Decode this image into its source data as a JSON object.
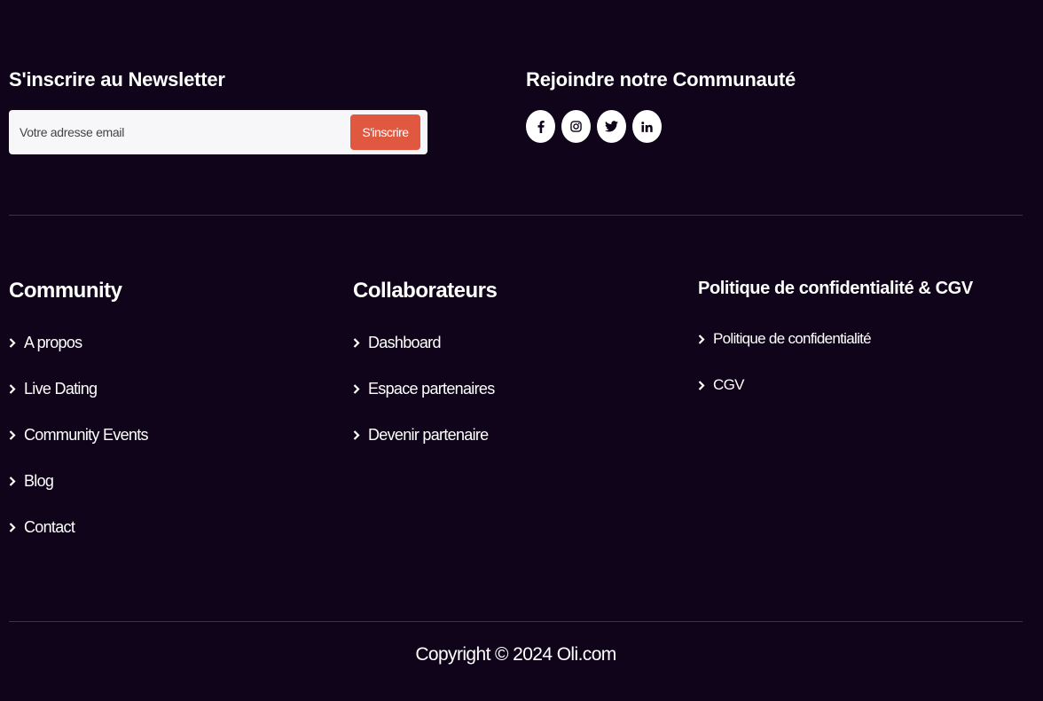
{
  "newsletter": {
    "title": "S'inscrire au Newsletter",
    "email_placeholder": "Votre adresse email",
    "submit_label": "S'inscrire"
  },
  "community": {
    "title": "Rejoindre notre Communauté",
    "socials": [
      {
        "icon": "facebook-icon"
      },
      {
        "icon": "instagram-icon"
      },
      {
        "icon": "twitter-icon"
      },
      {
        "icon": "linkedin-icon"
      }
    ]
  },
  "columns": [
    {
      "title": "Community",
      "links": [
        "A propos",
        "Live Dating",
        "Community Events",
        "Blog",
        "Contact"
      ]
    },
    {
      "title": "Collaborateurs",
      "links": [
        "Dashboard",
        "Espace partenaires",
        "Devenir partenaire"
      ]
    },
    {
      "title": "Politique de confidentialité & CGV",
      "links": [
        "Politique de confidentialité",
        "CGV"
      ]
    }
  ],
  "footer": {
    "copyright": "Copyright © 2024 Oli.com"
  },
  "colors": {
    "background": "#0f0419",
    "accent": "#e0583f",
    "text": "#ffffff"
  }
}
